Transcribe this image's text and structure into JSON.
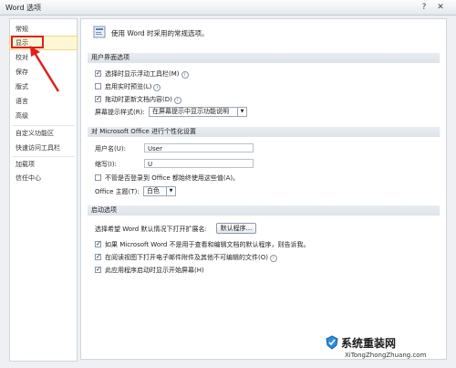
{
  "window": {
    "title": "Word 选项",
    "help_glyph": "?",
    "close_glyph": "✕"
  },
  "sidebar": {
    "items": [
      {
        "label": "常规"
      },
      {
        "label": "显示"
      },
      {
        "label": "校对"
      },
      {
        "label": "保存"
      },
      {
        "label": "版式"
      },
      {
        "label": "语言"
      },
      {
        "label": "高级"
      },
      {
        "label": "自定义功能区"
      },
      {
        "label": "快速访问工具栏"
      },
      {
        "label": "加载项"
      },
      {
        "label": "信任中心"
      }
    ],
    "selected": "显示"
  },
  "main": {
    "intro": "使用 Word 时采用的常规选项。",
    "ui_section": {
      "title": "用户界面选项",
      "opt1": "选择时显示浮动工具栏(M)",
      "opt2": "启用实时预览(L)",
      "opt3": "拖动时更新文档内容(D)",
      "tip_label": "屏幕提示样式(R):",
      "tip_value": "在屏幕提示中显示功能说明"
    },
    "personal_section": {
      "title": "对 Microsoft Office 进行个性化设置",
      "username_label": "用户名(U):",
      "username_value": "User",
      "initials_label": "缩写(I):",
      "initials_value": "U",
      "always_use": "不管是否登录到 Office 都始终使用这些值(A)。",
      "theme_label": "Office 主题(T):",
      "theme_value": "白色"
    },
    "startup_section": {
      "title": "启动选项",
      "ext_label": "选择希望 Word 默认情况下打开扩展名:",
      "ext_button": "默认程序...",
      "opt1": "如果 Microsoft Word 不是用于查看和编辑文档的默认程序，则告诉我。",
      "opt2": "在阅读视图下打开电子邮件附件及其他不可编辑的文件(O)",
      "opt3": "此应用程序启动时显示开始屏幕(H)"
    }
  },
  "watermark": {
    "text": "系统重装网",
    "url": "XiTongZhongZhuang.com"
  },
  "colors": {
    "highlight_box": "#e02020",
    "section_bg": "#dde3ea",
    "selected_bg": "#fdf7d6"
  }
}
